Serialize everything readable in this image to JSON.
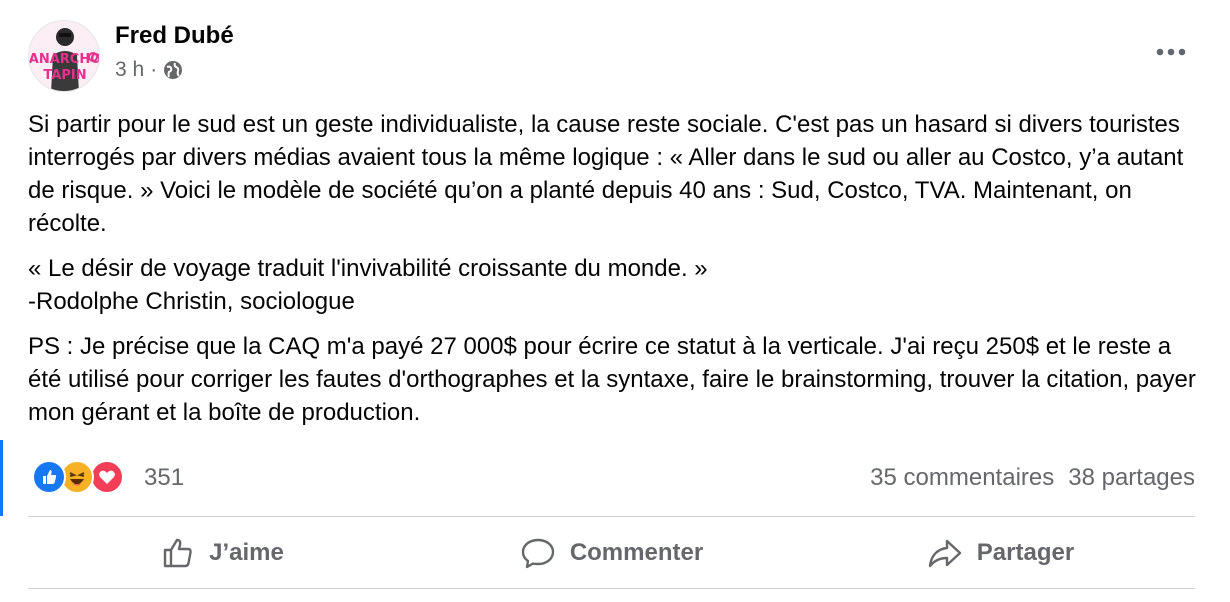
{
  "post": {
    "author": "Fred Dubé",
    "time": "3 h",
    "separator": "·",
    "paragraphs": [
      "Si partir pour le sud est un geste individualiste, la cause reste sociale. C'est pas un hasard si divers touristes interrogés par divers médias avaient tous la même logique : « Aller dans le sud ou aller au Costco, y’a autant de risque. » Voici le modèle de société qu’on a planté depuis 40 ans : Sud, Costco, TVA. Maintenant, on récolte.",
      "« Le désir de voyage traduit l'invivabilité croissante du monde. »",
      "-Rodolphe Christin, sociologue",
      "PS : Je précise que la CAQ m'a payé 27 000$ pour écrire ce statut à la verticale. J'ai reçu 250$ et le reste a été utilisé pour corriger les fautes d'orthographes et la syntaxe, faire le brainstorming, trouver la citation, payer mon gérant et la boîte de production."
    ],
    "avatar_text": "ANARCHO TAPIN"
  },
  "stats": {
    "reaction_count": "351",
    "comments": "35 commentaires",
    "shares": "38 partages",
    "reaction_icons": [
      "like-icon",
      "haha-icon",
      "love-icon"
    ]
  },
  "actions": {
    "like": "J’aime",
    "comment": "Commenter",
    "share": "Partager"
  },
  "colors": {
    "accent": "#1877f2",
    "muted": "#65676b",
    "love": "#f33e58",
    "haha": "#f7b125"
  }
}
